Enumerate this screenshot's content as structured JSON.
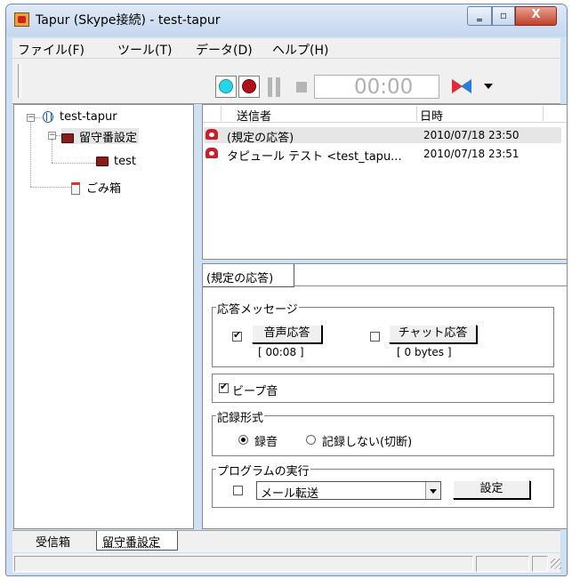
{
  "window": {
    "title": "Tapur (Skype接続) - test-tapur",
    "controls": {
      "minimize": "‗",
      "maximize": "▫",
      "close": "X"
    }
  },
  "menu": [
    "ファイル(F)",
    "ツール(T)",
    "データ(D)",
    "ヘルプ(H)"
  ],
  "toolbar": {
    "timer": "00:00",
    "icons": [
      "play-icon",
      "record-icon",
      "pause-icon",
      "stop-icon",
      "transfer-icon",
      "dropdown-arrow-icon"
    ]
  },
  "tree": {
    "root": "test-tapur",
    "items": [
      {
        "label": "留守番設定",
        "icon": "folder-icon"
      },
      {
        "label": "test",
        "icon": "folder-icon"
      },
      {
        "label": "ごみ箱",
        "icon": "trash-icon"
      }
    ]
  },
  "list": {
    "columns": [
      "送信者",
      "日時"
    ],
    "rows": [
      {
        "sender": "(規定の応答)",
        "date": "2010/07/18 23:50"
      },
      {
        "sender": "タピュール テスト <test_tapu...",
        "date": "2010/07/18 23:51"
      }
    ]
  },
  "detail": {
    "tab": "(規定の応答)",
    "response_group": {
      "title": "応答メッセージ",
      "voice": {
        "label": "音声応答",
        "checked": true,
        "info": "[ 00:08 ]"
      },
      "chat": {
        "label": "チャット応答",
        "checked": false,
        "info": "[ 0 bytes ]"
      }
    },
    "beep": {
      "label": "ビープ音",
      "checked": true
    },
    "record_format": {
      "title": "記録形式",
      "options": [
        "録音",
        "記録しない(切断)"
      ],
      "selected": "録音"
    },
    "program": {
      "title": "プログラムの実行",
      "checked": false,
      "select_value": "メール転送",
      "settings_button": "設定"
    }
  },
  "bottom_tabs": [
    "受信箱",
    "留守番設定"
  ],
  "active_bottom_tab": "留守番設定"
}
